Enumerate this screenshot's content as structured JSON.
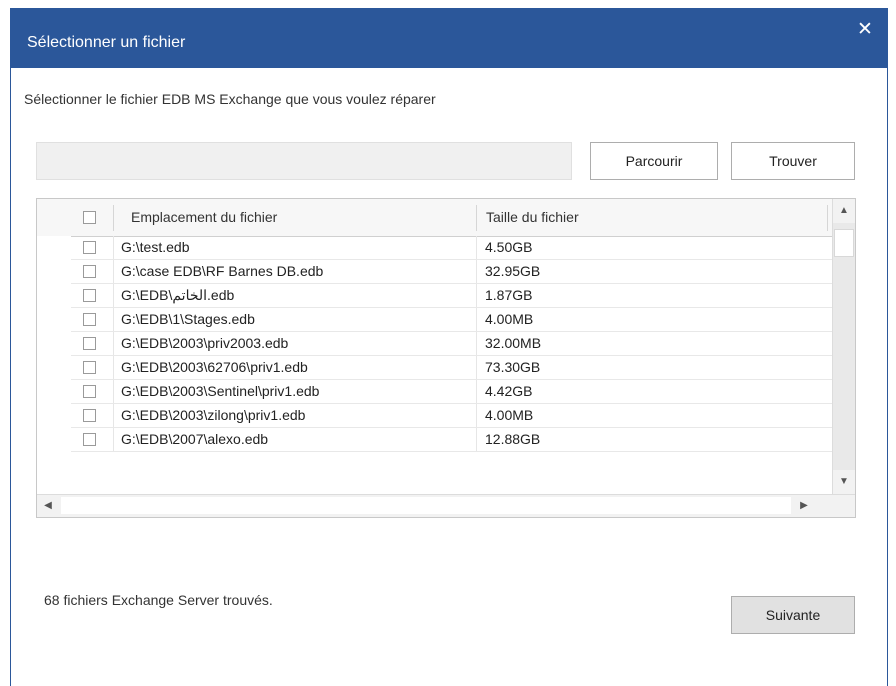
{
  "dialog": {
    "title": "Sélectionner un fichier",
    "close_glyph": "✕",
    "instruction": "Sélectionner le fichier EDB MS Exchange que vous voulez réparer"
  },
  "path_input": {
    "value": "",
    "placeholder": ""
  },
  "buttons": {
    "browse": "Parcourir",
    "find": "Trouver",
    "next": "Suivante"
  },
  "grid": {
    "headers": {
      "location": "Emplacement du fichier",
      "size": "Taille du fichier"
    },
    "rows": [
      {
        "path": "G:\\test.edb",
        "size": "4.50GB",
        "checked": false
      },
      {
        "path": "G:\\case EDB\\RF Barnes DB.edb",
        "size": "32.95GB",
        "checked": false
      },
      {
        "path": "G:\\EDB\\الخاتم.edb",
        "size": "1.87GB",
        "checked": false
      },
      {
        "path": "G:\\EDB\\1\\Stages.edb",
        "size": "4.00MB",
        "checked": false
      },
      {
        "path": "G:\\EDB\\2003\\priv2003.edb",
        "size": "32.00MB",
        "checked": false
      },
      {
        "path": "G:\\EDB\\2003\\62706\\priv1.edb",
        "size": "73.30GB",
        "checked": false
      },
      {
        "path": "G:\\EDB\\2003\\Sentinel\\priv1.edb",
        "size": "4.42GB",
        "checked": false
      },
      {
        "path": "G:\\EDB\\2003\\zilong\\priv1.edb",
        "size": "4.00MB",
        "checked": false
      },
      {
        "path": "G:\\EDB\\2007\\alexo.edb",
        "size": "12.88GB",
        "checked": false
      }
    ]
  },
  "status": "68 fichiers Exchange Server trouvés.",
  "colors": {
    "titlebar": "#2b579a",
    "input_bg": "#f0f0f0",
    "next_button_bg": "#e1e1e1"
  },
  "icons": {
    "scroll_up": "▲",
    "scroll_down": "▼",
    "scroll_left": "◀",
    "scroll_right": "▶"
  }
}
